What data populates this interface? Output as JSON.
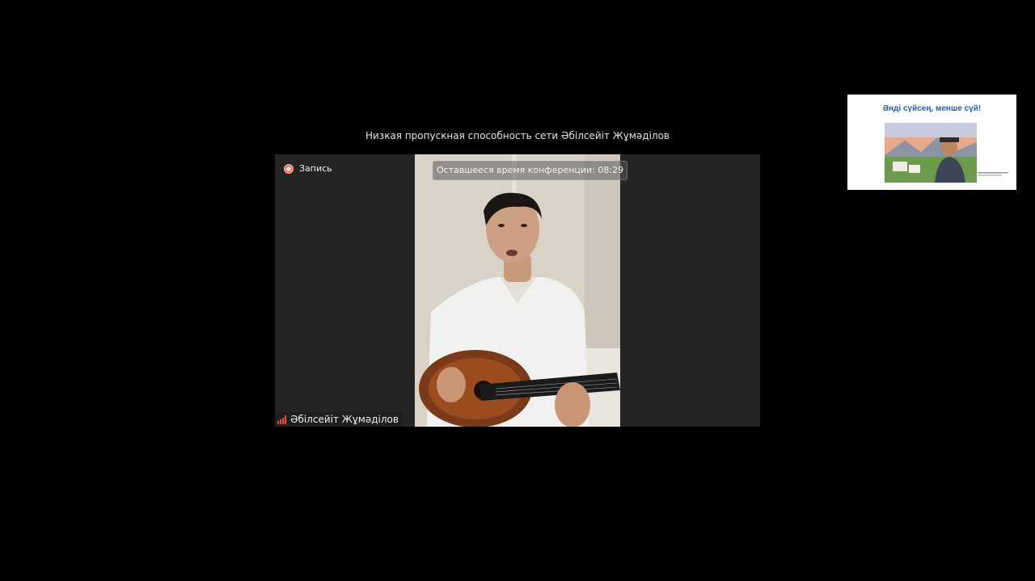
{
  "notice": {
    "text": "Низкая пропускная способность сети Әбілсейіт Жұмәділов"
  },
  "video": {
    "recording_label": "Запись",
    "time_remaining": "Оставшееся время конференции: 08:29",
    "participant_name": "Әбілсейіт Жұмәділов",
    "network_status_icon": "signal-bars-icon"
  },
  "shared_screen": {
    "slide_title": "Әнді сүйсең, менше сүй!"
  },
  "colors": {
    "background": "#000000",
    "tile_background": "#242424",
    "recording": "#e8483a",
    "signal": "#e74c3c",
    "slide_title": "#2a5b9c"
  }
}
